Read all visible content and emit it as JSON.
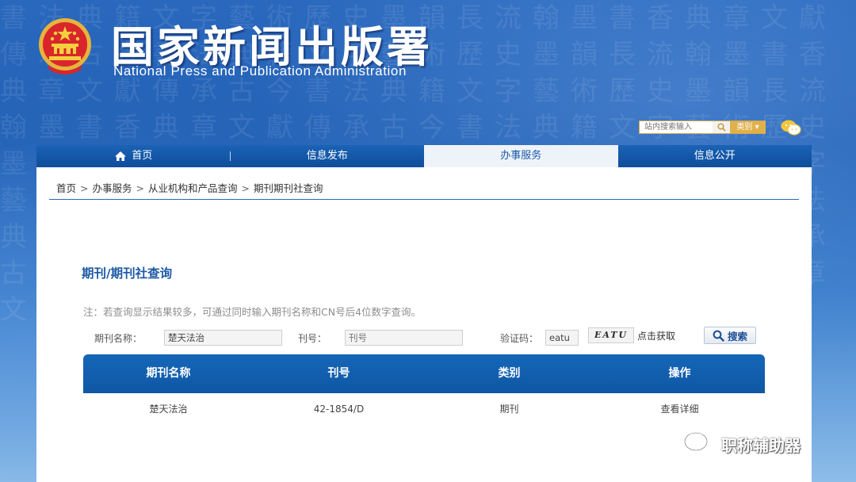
{
  "header": {
    "title": "国家新闻出版署",
    "subtitle": "National Press and Publication Administration"
  },
  "search": {
    "placeholder": "站内搜索输入",
    "category_label": "类别"
  },
  "nav": {
    "items": [
      {
        "label": "首页"
      },
      {
        "label": "信息发布"
      },
      {
        "label": "办事服务"
      },
      {
        "label": "信息公开"
      }
    ],
    "active_index": 2
  },
  "breadcrumb": {
    "items": [
      "首页",
      "办事服务",
      "从业机构和产品查询",
      "期刊期刊社查询"
    ],
    "separator": ">"
  },
  "page": {
    "title": "期刊/期刊社查询",
    "note": "注：若查询显示结果较多，可通过同时输入期刊名称和CN号后4位数字查询。"
  },
  "form": {
    "name_label": "期刊名称：",
    "name_value": "楚天法治",
    "issn_label": "刊号：",
    "issn_placeholder": "刊号",
    "captcha_label": "验证码：",
    "captcha_value": "eatu",
    "captcha_image_text": "EATU",
    "captcha_refresh": "点击获取",
    "submit_label": "搜索"
  },
  "results": {
    "columns": [
      "期刊名称",
      "刊号",
      "类别",
      "操作"
    ],
    "rows": [
      [
        "楚天法治",
        "42-1854/D",
        "期刊",
        "查看详细"
      ]
    ]
  },
  "watermark": {
    "text": "职称辅助器"
  },
  "colors": {
    "brand_blue": "#0f57a4",
    "title_blue": "#1f5aa6",
    "accent_gold": "#e2b04a"
  }
}
